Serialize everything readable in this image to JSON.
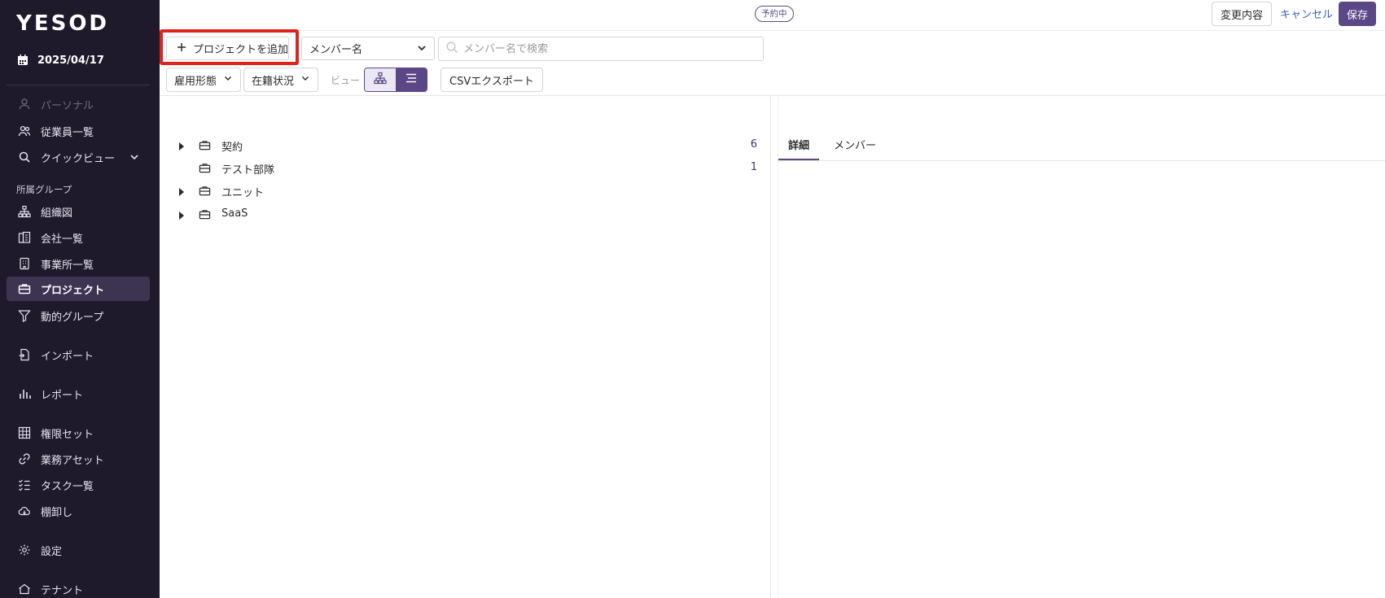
{
  "app": {
    "logo": "YESOD"
  },
  "sidebar": {
    "date": "2025/04/17",
    "items_top": [
      {
        "label": "パーソナル",
        "icon": "user-icon",
        "disabled": true
      },
      {
        "label": "従業員一覧",
        "icon": "users-icon"
      },
      {
        "label": "クイックビュー",
        "icon": "search-icon",
        "has_chevron": true
      }
    ],
    "section_label": "所属グループ",
    "items_group": [
      {
        "label": "組織図",
        "icon": "org-chart-icon"
      },
      {
        "label": "会社一覧",
        "icon": "company-icon"
      },
      {
        "label": "事業所一覧",
        "icon": "building-icon"
      },
      {
        "label": "プロジェクト",
        "icon": "briefcase-icon",
        "active": true
      },
      {
        "label": "動的グループ",
        "icon": "filter-icon"
      }
    ],
    "import_label": "インポート",
    "report_label": "レポート",
    "items_admin": [
      {
        "label": "権限セット",
        "icon": "grid-icon"
      },
      {
        "label": "業務アセット",
        "icon": "link-icon"
      },
      {
        "label": "タスク一覧",
        "icon": "checklist-icon"
      },
      {
        "label": "棚卸し",
        "icon": "cloud-icon"
      }
    ],
    "settings_label": "設定",
    "tenant_label": "テナント"
  },
  "topbar": {
    "status_badge": "予約中",
    "changes_label": "変更内容",
    "cancel_label": "キャンセル",
    "save_label": "保存"
  },
  "toolbar": {
    "add_project_label": "プロジェクトを追加",
    "member_select_value": "メンバー名",
    "search_placeholder": "メンバー名で検索",
    "employment_filter": "雇用形態",
    "status_filter": "在籍状況",
    "view_label": "ビュー",
    "csv_export_label": "CSVエクスポート"
  },
  "tree": [
    {
      "label": "契約",
      "count": "6",
      "expandable": true
    },
    {
      "label": "テスト部隊",
      "count": "1",
      "expandable": false
    },
    {
      "label": "ユニット",
      "count": "",
      "expandable": true
    },
    {
      "label": "SaaS",
      "count": "",
      "expandable": true
    }
  ],
  "detail": {
    "tabs": [
      {
        "label": "詳細",
        "active": true
      },
      {
        "label": "メンバー",
        "active": false
      }
    ]
  },
  "colors": {
    "sidebar_bg": "#1f1a2b",
    "accent": "#5b4686",
    "highlight": "#e0241b",
    "link": "#3b5fb4"
  }
}
